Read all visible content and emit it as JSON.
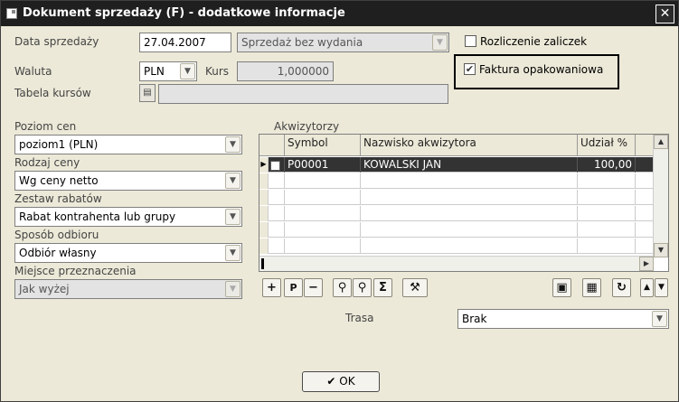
{
  "window": {
    "title": "Dokument sprzedaży (F) - dodatkowe informacje",
    "close_glyph": "✕"
  },
  "form": {
    "data_sprzedazy_label": "Data sprzedaży",
    "data_sprzedazy_value": "27.04.2007",
    "sprzedaz_option": "Sprzedaż bez wydania",
    "waluta_label": "Waluta",
    "waluta_value": "PLN",
    "kurs_label": "Kurs",
    "kurs_value": "1,000000",
    "tabela_kursow_label": "Tabela kursów",
    "tabela_kursow_value": "",
    "rozliczenie_zaliczek_label": "Rozliczenie zaliczek",
    "rozliczenie_zaliczek_checked": false,
    "faktura_opakowaniowa_label": "Faktura opakowaniowa",
    "faktura_opakowaniowa_checked": true,
    "poziom_cen_label": "Poziom cen",
    "poziom_cen_value": "poziom1 (PLN)",
    "rodzaj_ceny_label": "Rodzaj ceny",
    "rodzaj_ceny_value": "Wg ceny netto",
    "zestaw_rabatow_label": "Zestaw rabatów",
    "zestaw_rabatow_value": "Rabat kontrahenta lub grupy",
    "sposob_odbioru_label": "Sposób odbioru",
    "sposob_odbioru_value": "Odbiór własny",
    "miejsce_przeznaczenia_label": "Miejsce przeznaczenia",
    "miejsce_przeznaczenia_value": "Jak wyżej",
    "trasa_label": "Trasa",
    "trasa_value": "Brak"
  },
  "akwizytorzy": {
    "label": "Akwizytorzy",
    "columns": [
      "Symbol",
      "Nazwisko akwizytora",
      "Udział %"
    ],
    "rows": [
      {
        "symbol": "P00001",
        "nazwisko": "KOWALSKI JAN",
        "udzial": "100,00"
      }
    ]
  },
  "toolbar": {
    "add_glyph": "+",
    "p_glyph": "P",
    "remove_glyph": "−",
    "find_glyph": "⚲",
    "find2_glyph": "⚲",
    "sum_glyph": "Σ",
    "tools_glyph": "⚒",
    "save_glyph": "▣",
    "table_glyph": "▦",
    "refresh_glyph": "↻",
    "up_glyph": "▲",
    "down_glyph": "▼"
  },
  "ok_button": {
    "label": "OK",
    "glyph": "✔"
  }
}
